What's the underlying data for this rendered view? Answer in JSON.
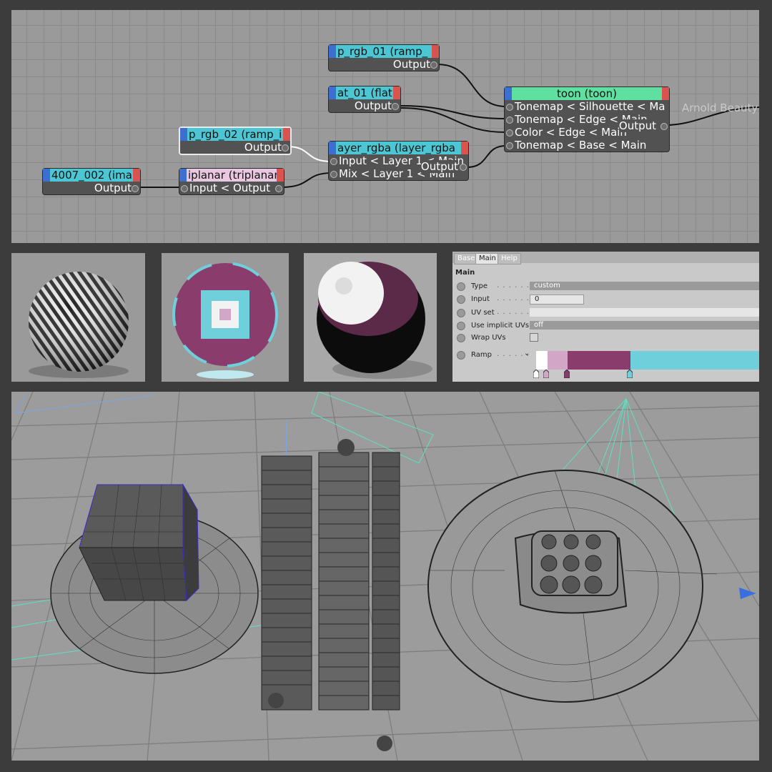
{
  "nodes": {
    "ramp_rgb_01": {
      "title": "p_rgb_01 (ramp_",
      "output": "Output",
      "header_color": "#4cc6d3"
    },
    "flat_01": {
      "title": "at_01 (flat",
      "output": "Output",
      "header_color": "#4cc6d3"
    },
    "ramp_rgb_02": {
      "title": "p_rgb_02 (ramp_i",
      "output": "Output",
      "header_color": "#4cc6d3"
    },
    "image_4007": {
      "title": "4007_002 (ima",
      "output": "Output",
      "header_color": "#4cc6d3"
    },
    "triplanar": {
      "title": "iplanar (triplanar",
      "input": "Input < Output",
      "header_color": "#e8c7e0"
    },
    "layer_rgba": {
      "title": "ayer_rgba (layer_rgba",
      "input1": "Input < Layer 1 < Main",
      "input2": "Mix < Layer 1 < Main",
      "output": "Output",
      "header_color": "#4cc6d3"
    },
    "toon": {
      "title": "toon (toon)",
      "in1": "Tonemap < Silhouette < Ma",
      "in2": "Tonemap < Edge < Main",
      "in3": "Color < Edge < Main",
      "in4": "Tonemap < Base < Main",
      "output": "Output",
      "header_color": "#5fe0a0"
    }
  },
  "arnold_beauty": "Arnold Beauty",
  "swatches": [
    "striped-sphere",
    "triplanar-sphere",
    "toon-sphere"
  ],
  "attr_editor": {
    "tabs": [
      "Base",
      "Main",
      "Help"
    ],
    "active_tab": "Main",
    "section": "Main",
    "rows": {
      "type": {
        "label": "Type",
        "value": "custom"
      },
      "input": {
        "label": "Input",
        "value": "0"
      },
      "uv_set": {
        "label": "UV set",
        "value": ""
      },
      "use_implicit_uvs": {
        "label": "Use implicit UVs",
        "value": "off"
      },
      "wrap_uvs": {
        "label": "Wrap UVs"
      },
      "ramp": {
        "label": "Ramp"
      }
    },
    "ramp_stops": [
      {
        "position": 0.0,
        "color": "#ffffff"
      },
      {
        "position": 0.05,
        "color": "#d2a6c7"
      },
      {
        "position": 0.14,
        "color": "#8a3c6c"
      },
      {
        "position": 0.42,
        "color": "#6fcfdb"
      }
    ]
  },
  "colors": {
    "wire_cyan": "#5fe0c0",
    "wire_blue": "#7aa6e6",
    "selection_purple": "#3a2ad0",
    "arrow_blue": "#3a6fe0"
  }
}
